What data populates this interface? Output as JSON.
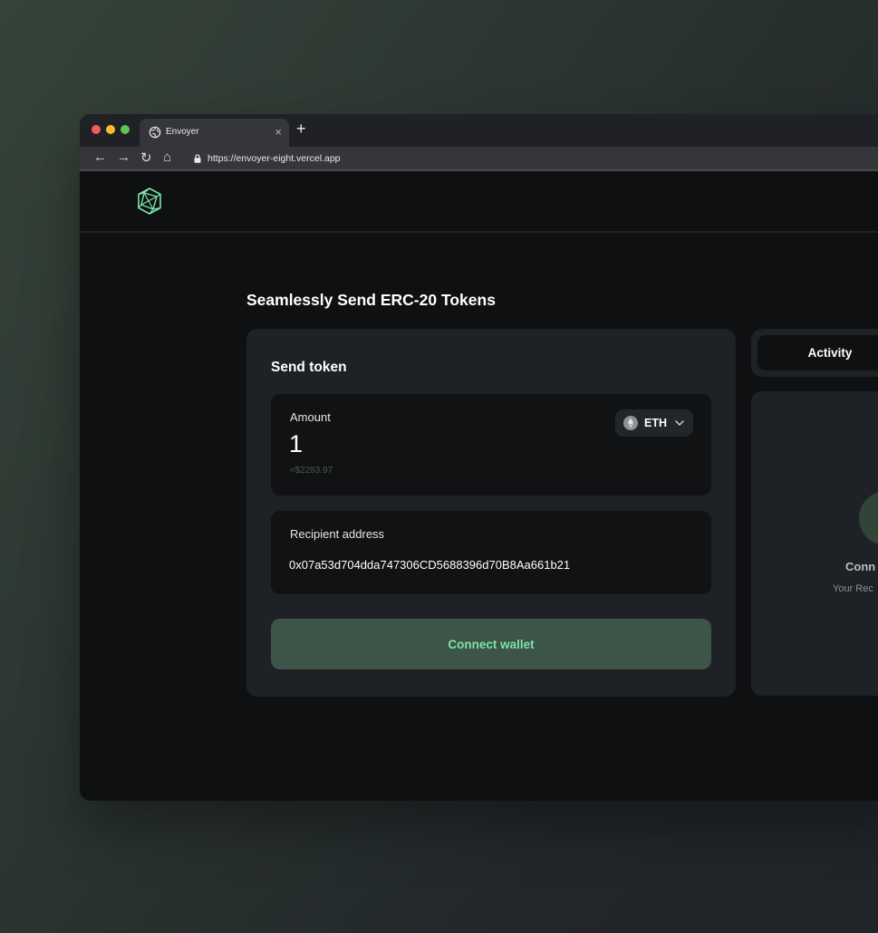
{
  "browser": {
    "tab_title": "Envoyer",
    "tab_close": "×",
    "new_tab": "+",
    "url": "https://envoyer-eight.vercel.app",
    "nav": {
      "back": "←",
      "forward": "→",
      "reload": "↻",
      "home": "⌂"
    }
  },
  "page": {
    "title": "Seamlessly Send ERC-20 Tokens"
  },
  "send_card": {
    "title": "Send token",
    "amount": {
      "label": "Amount",
      "value": "1",
      "usd_estimate": "≈$2283.97"
    },
    "token": {
      "symbol": "ETH",
      "icon": "eth-icon"
    },
    "recipient": {
      "label": "Recipient address",
      "value": "0x07a53d704dda747306CD5688396d70B8Aa661b21"
    },
    "connect_button": "Connect wallet"
  },
  "side_panel": {
    "tabs": [
      "Activity"
    ],
    "empty_state": {
      "title": "Conn",
      "description": "Your Rec"
    }
  },
  "colors": {
    "accent": "#7de3a8",
    "button_bg": "#3d5449",
    "card_bg": "#1e2125",
    "field_bg": "#111214",
    "app_bg": "#0f1012"
  }
}
